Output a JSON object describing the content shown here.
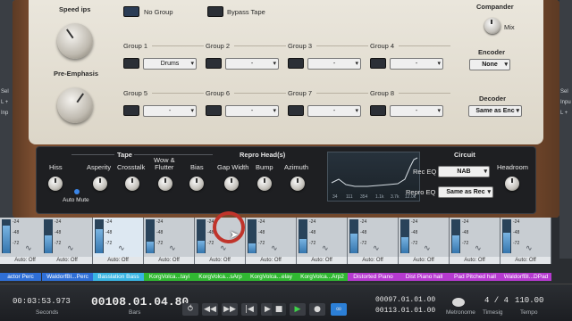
{
  "plugin": {
    "top": {
      "speed_label": "Speed ips",
      "pre_emphasis_label": "Pre-Emphasis",
      "no_group_label": "No Group",
      "bypass_tape_label": "Bypass Tape",
      "compander_label": "Compander",
      "mix_label": "Mix",
      "encoder_label": "Encoder",
      "encoder_value": "None",
      "decoder_label": "Decoder",
      "decoder_value": "Same as Enc"
    },
    "groups": [
      {
        "label": "Group 1",
        "value": "Drums"
      },
      {
        "label": "Group 2",
        "value": "-"
      },
      {
        "label": "Group 3",
        "value": "-"
      },
      {
        "label": "Group 4",
        "value": "-"
      },
      {
        "label": "Group 5",
        "value": "-"
      },
      {
        "label": "Group 6",
        "value": "-"
      },
      {
        "label": "Group 7",
        "value": "-"
      },
      {
        "label": "Group 8",
        "value": "-"
      }
    ],
    "tape": {
      "section_label": "Tape",
      "knobs": [
        "Hiss",
        "Asperity",
        "Crosstalk",
        "Wow &\nFlutter",
        "Bias"
      ],
      "auto_mute_label": "Auto Mute"
    },
    "repro": {
      "section_label": "Repro Head(s)",
      "knobs": [
        "Gap Width",
        "Bump",
        "Azimuth"
      ]
    },
    "analyzer": {
      "ticks": [
        "34",
        "111",
        "354",
        "1.1k",
        "3.7k",
        "12.0k"
      ]
    },
    "circuit": {
      "section_label": "Circuit",
      "rec_eq_label": "Rec EQ",
      "rec_eq_value": "NAB",
      "repro_eq_label": "Repro EQ",
      "repro_eq_value": "Same as Rec",
      "headroom_label": "Headroom"
    }
  },
  "side": {
    "left_labels": [
      "Sel",
      "L +",
      "Inp"
    ],
    "right_labels": [
      "Sel",
      "Inpu",
      "L +"
    ]
  },
  "channels": [
    {
      "name": "actor Perc",
      "auto": "Auto: Off",
      "color": "#2f6fd6",
      "level": 0.85
    },
    {
      "name": "WaldorfBl...Perc",
      "auto": "Auto: Off",
      "color": "#2f6fd6",
      "level": 0.55
    },
    {
      "name": "Basslation Bass",
      "auto": "Auto: Off",
      "color": "#39b5e3",
      "level": 0.75
    },
    {
      "name": "KorgVolca...tayi",
      "auto": "Auto: Off",
      "color": "#30b832",
      "level": 0.35
    },
    {
      "name": "KorgVolca...sArp",
      "auto": "Auto: Off",
      "color": "#30b832",
      "level": 0.4
    },
    {
      "name": "KorgVolca...elay",
      "auto": "Auto: Off",
      "color": "#30b832",
      "level": 0.3
    },
    {
      "name": "KorgVolca...Arp2",
      "auto": "Auto: Off",
      "color": "#30b832",
      "level": 0.45
    },
    {
      "name": "Distorted Piano",
      "auto": "Auto: Off",
      "color": "#b63ad0",
      "level": 0.6
    },
    {
      "name": "Dist Piano hall",
      "auto": "Auto: Off",
      "color": "#b63ad0",
      "level": 0.5
    },
    {
      "name": "Pad Pitched hall",
      "auto": "Auto: Off",
      "color": "#b63ad0",
      "level": 0.55
    },
    {
      "name": "WaldorfBl...DPad",
      "auto": "Auto: Off",
      "color": "#b63ad0",
      "level": 0.65
    }
  ],
  "db_marks": [
    "-24",
    "-48",
    "-72"
  ],
  "transport": {
    "seconds_value": "00:03:53.973",
    "seconds_label": "Seconds",
    "bars_value": "00108.01.04.80",
    "bars_label": "Bars",
    "loop_start": "00097.01.01.00",
    "loop_end": "00113.01.01.00",
    "metronome_label": "Metronome",
    "timesig_value": "4 / 4",
    "timesig_label": "Timesig",
    "tempo_value": "110.00",
    "tempo_label": "Tempo"
  }
}
